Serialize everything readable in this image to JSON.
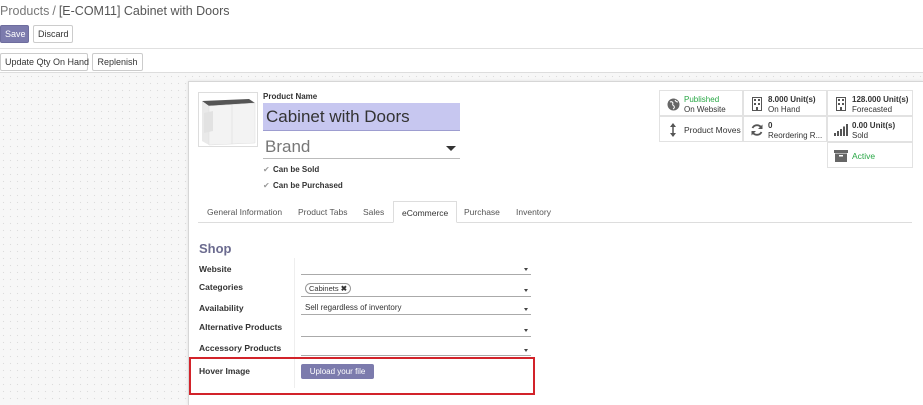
{
  "breadcrumb": {
    "parent": "Products",
    "separator": "/",
    "current": "[E-COM11] Cabinet with Doors"
  },
  "toolbar": {
    "save_label": "Save",
    "discard_label": "Discard"
  },
  "actions": {
    "update_qty_label": "Update Qty On Hand",
    "replenish_label": "Replenish"
  },
  "product": {
    "name_label": "Product Name",
    "name_value": "Cabinet with Doors",
    "brand_placeholder": "Brand",
    "can_be_sold": "Can be Sold",
    "can_be_purchased": "Can be Purchased"
  },
  "stat_buttons": {
    "published": {
      "line1": "Published",
      "line2": "On Website",
      "icon": "globe-icon"
    },
    "on_hand": {
      "line1": "8.000 Unit(s)",
      "line2": "On Hand",
      "icon": "building-icon"
    },
    "forecasted": {
      "line1": "128.000 Unit(s)",
      "line2": "Forecasted",
      "icon": "building-icon"
    },
    "product_moves": {
      "label": "Product Moves",
      "icon": "arrows-v-icon"
    },
    "reordering": {
      "line1": "0",
      "line2": "Reordering R...",
      "icon": "refresh-icon"
    },
    "sold": {
      "line1": "0.00 Unit(s)",
      "line2": "Sold",
      "icon": "signal-icon"
    },
    "active": {
      "label": "Active",
      "icon": "archive-icon"
    }
  },
  "tabs": [
    "General Information",
    "Product Tabs",
    "Sales",
    "eCommerce",
    "Purchase",
    "Inventory"
  ],
  "active_tab": "eCommerce",
  "shop": {
    "section_title": "Shop",
    "website_label": "Website",
    "categories_label": "Categories",
    "category_tag": "Cabinets",
    "availability_label": "Availability",
    "availability_value": "Sell regardless of inventory",
    "alternative_label": "Alternative Products",
    "accessory_label": "Accessory Products",
    "hover_image_label": "Hover Image",
    "upload_label": "Upload your file"
  },
  "colors": {
    "accent": "#7c7bad",
    "name_highlight": "#c7c7f0",
    "published": "#28a745",
    "annotation": "#d2232a"
  }
}
